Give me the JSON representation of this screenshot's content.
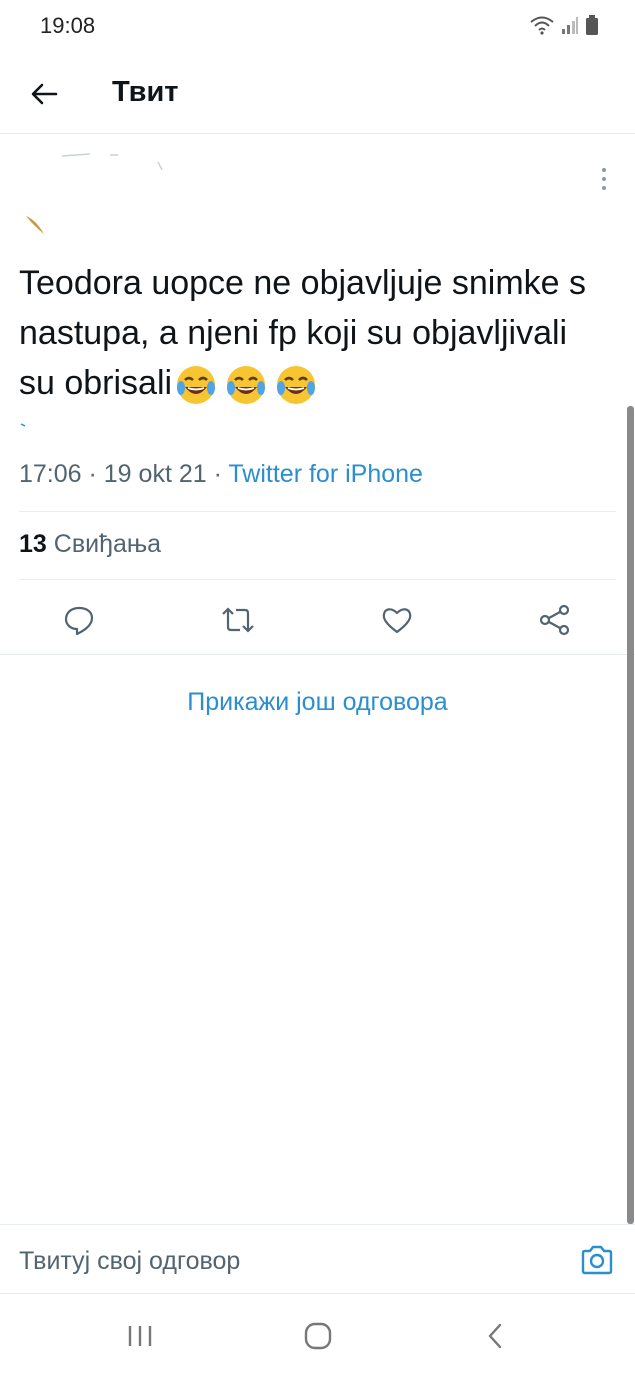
{
  "status_bar": {
    "time": "19:08",
    "icons": [
      "wifi-icon",
      "signal-icon",
      "battery-icon"
    ]
  },
  "header": {
    "title": "Твит",
    "back_icon": "arrow-left-icon"
  },
  "tweet": {
    "text": "Teodora uopce ne objavljuje snimke s nastupa, a njeni fp koji su objavljivali su obrisali",
    "emojis": [
      "😂",
      "😂",
      "😂"
    ],
    "time": "17:06",
    "sep1": " · ",
    "date": "19 okt 21",
    "sep2": " · ",
    "source": "Twitter for iPhone",
    "likes_count": "13",
    "likes_label": "Свиђања"
  },
  "actions": [
    "reply-icon",
    "retweet-icon",
    "like-icon",
    "share-icon"
  ],
  "more_replies_label": "Прикажи још одговора",
  "reply_bar": {
    "placeholder": "Твитуј свој одговор",
    "camera_icon": "camera-icon"
  },
  "nav_bar": [
    "recent-apps-icon",
    "home-icon",
    "back-icon"
  ],
  "colors": {
    "accent": "#2b8ecf",
    "secondary_text": "#536471",
    "primary_text": "#0f1419",
    "divider": "#e6ecf0"
  }
}
